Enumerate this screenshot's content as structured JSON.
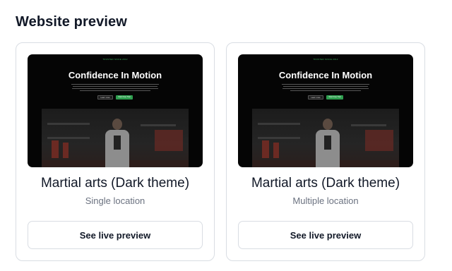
{
  "section": {
    "title": "Website preview"
  },
  "cards": [
    {
      "preview": {
        "eyebrow": "TRUSTED SINCE 2012",
        "headline": "Confidence In Motion",
        "primary_btn": "Start Free Trial",
        "secondary_btn": "Learn more"
      },
      "title": "Martial arts (Dark theme)",
      "subtitle": "Single location",
      "cta": "See live preview"
    },
    {
      "preview": {
        "eyebrow": "TRUSTED SINCE 2012",
        "headline": "Confidence In Motion",
        "primary_btn": "Start Free Trial",
        "secondary_btn": "Learn more"
      },
      "title": "Martial arts (Dark theme)",
      "subtitle": "Multiple location",
      "cta": "See live preview"
    }
  ],
  "colors": {
    "accent_green": "#2f9e4f",
    "preview_bg": "#050505",
    "muted_text": "#6b7280",
    "border": "#d9dde3"
  }
}
